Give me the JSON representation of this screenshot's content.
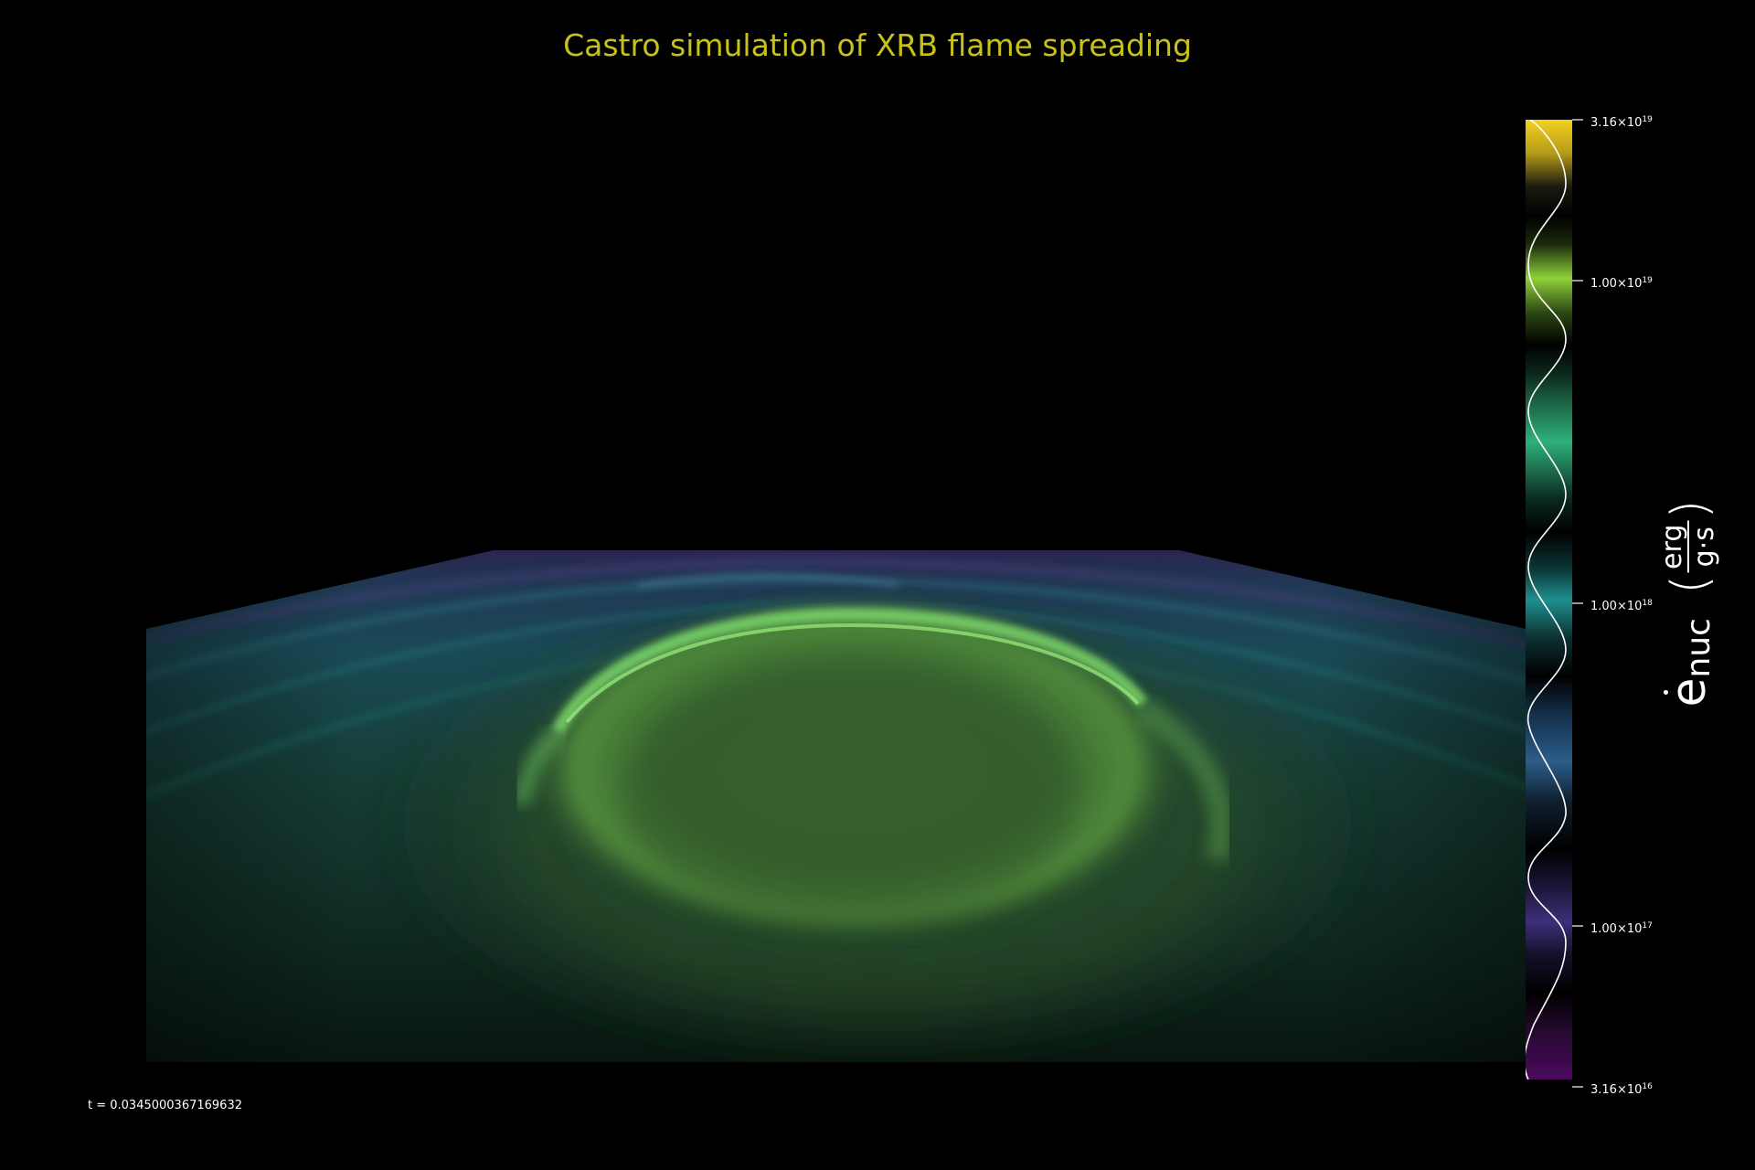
{
  "title": "Castro simulation of XRB flame spreading",
  "title_color": "#c8c217",
  "colorbar": {
    "ticks": [
      {
        "mantissa": "3.16",
        "exponent": "19"
      },
      {
        "mantissa": "1.00",
        "exponent": "19"
      },
      {
        "mantissa": "1.00",
        "exponent": "18"
      },
      {
        "mantissa": "1.00",
        "exponent": "17"
      },
      {
        "mantissa": "3.16",
        "exponent": "16"
      }
    ],
    "label": {
      "symbol": "e",
      "subscript": "nuc",
      "numerator": "erg",
      "denominator": "g·s"
    },
    "scale": "log",
    "range": [
      "3.16e16",
      "3.16e19"
    ],
    "band_colors": [
      "#f0d020",
      "#8fd23a",
      "#2fa874",
      "#1f8f8f",
      "#2c5d8a",
      "#3d2f7a",
      "#4a0a5c"
    ]
  },
  "time_label": "t = 0.0345000367169632"
}
